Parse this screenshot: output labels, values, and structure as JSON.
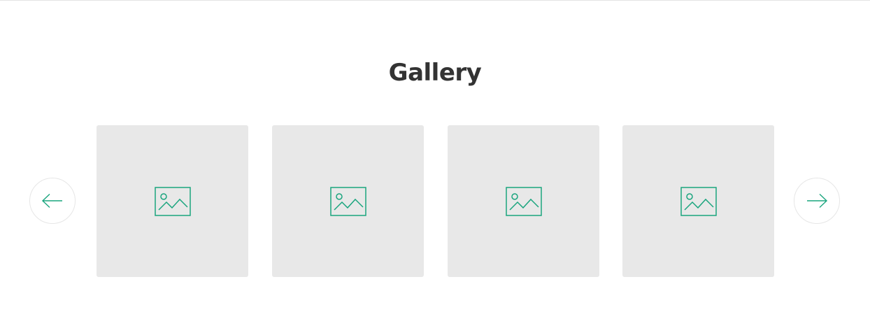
{
  "gallery": {
    "title": "Gallery",
    "accent_color": "#1aa57e",
    "placeholder_bg": "#e8e8e8",
    "prev_icon": "arrow-left-icon",
    "next_icon": "arrow-right-icon",
    "slides": [
      {
        "icon": "image-placeholder-icon"
      },
      {
        "icon": "image-placeholder-icon"
      },
      {
        "icon": "image-placeholder-icon"
      },
      {
        "icon": "image-placeholder-icon"
      }
    ]
  }
}
